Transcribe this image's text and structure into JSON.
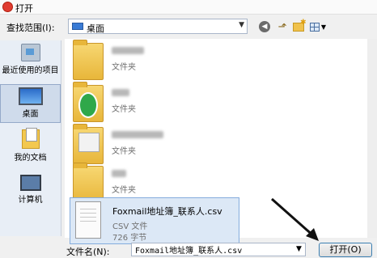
{
  "window": {
    "title": "打开"
  },
  "lookin": {
    "label": "查找范围(I):",
    "value": "桌面"
  },
  "places": [
    {
      "label": "最近使用的项目"
    },
    {
      "label": "桌面"
    },
    {
      "label": "我的文档"
    },
    {
      "label": "计算机"
    }
  ],
  "files": [
    {
      "type": "文件夹"
    },
    {
      "type": "文件夹"
    },
    {
      "type": "文件夹"
    },
    {
      "type": "文件夹"
    },
    {
      "name": "Foxmail地址簿_联系人.csv",
      "type": "CSV 文件",
      "size": "726 字节"
    }
  ],
  "bottom": {
    "filename_label": "文件名(N):",
    "filename_value": "Foxmail地址簿_联系人.csv",
    "open_label": "打开(O)"
  }
}
